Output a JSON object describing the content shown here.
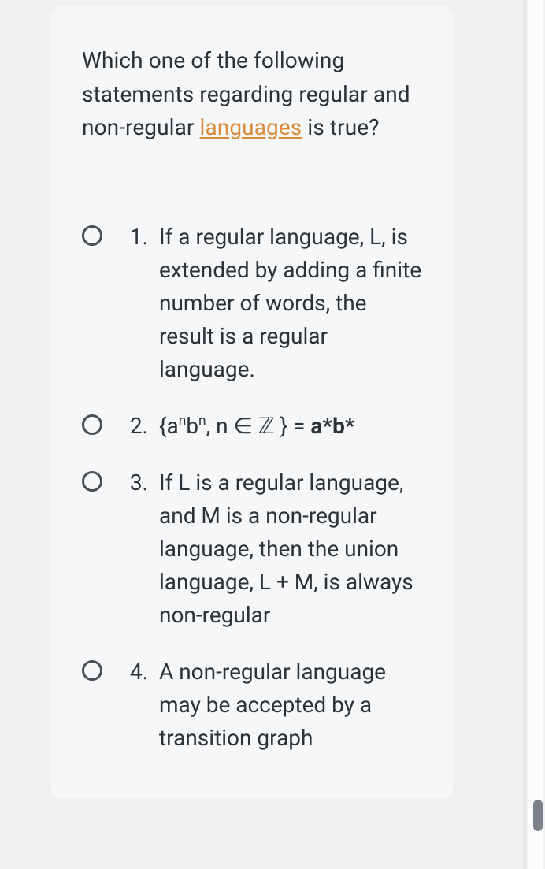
{
  "question": {
    "pre": "Which one of the following statements regarding regular and non-regular ",
    "link_text": "languages",
    "post": " is true?"
  },
  "options": [
    {
      "num": "1.",
      "html": "If a regular language, L, is extended by adding a finite number of words, the result is a regular language."
    },
    {
      "num": "2.",
      "html": "{a<sup>n</sup>b<sup>n</sup>, n ∈ ℤ } = <span class=\"bold\">a*b*</span>"
    },
    {
      "num": "3.",
      "html": "If L is a regular language, and M is a non-regular language, then the union language, L + M, is always non-regular"
    },
    {
      "num": "4.",
      "html": "A non-regular language may be accepted by a transition graph"
    }
  ]
}
